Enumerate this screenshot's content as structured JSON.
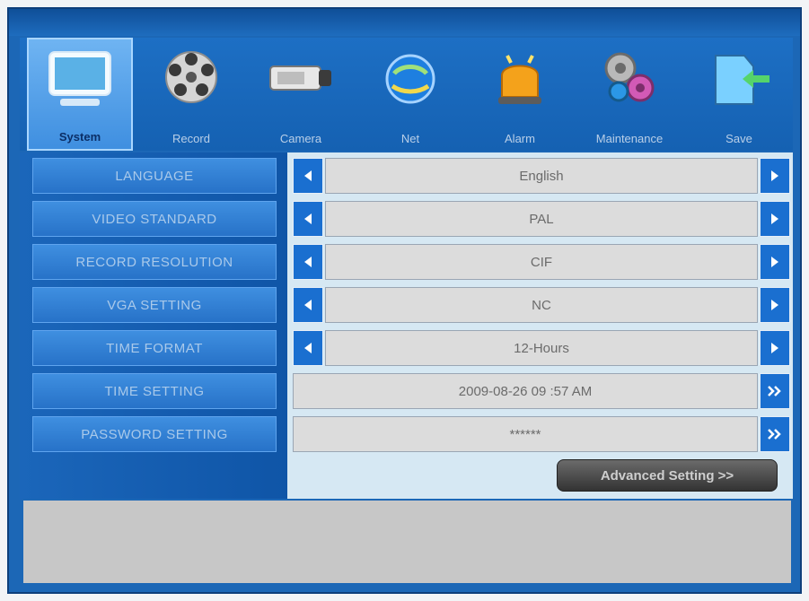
{
  "toolbar": {
    "tabs": [
      {
        "label": "System",
        "icon": "monitor-icon",
        "active": true
      },
      {
        "label": "Record",
        "icon": "film-reel-icon",
        "active": false
      },
      {
        "label": "Camera",
        "icon": "camera-icon",
        "active": false
      },
      {
        "label": "Net",
        "icon": "globe-icon",
        "active": false
      },
      {
        "label": "Alarm",
        "icon": "alarm-light-icon",
        "active": false
      },
      {
        "label": "Maintenance",
        "icon": "gears-icon",
        "active": false
      },
      {
        "label": "Save",
        "icon": "save-folder-icon",
        "active": false
      }
    ]
  },
  "settings": {
    "language": {
      "label": "LANGUAGE",
      "value": "English"
    },
    "video_standard": {
      "label": "VIDEO STANDARD",
      "value": "PAL"
    },
    "record_resolution": {
      "label": "RECORD RESOLUTION",
      "value": "CIF"
    },
    "vga_setting": {
      "label": "VGA SETTING",
      "value": "NC"
    },
    "time_format": {
      "label": "TIME FORMAT",
      "value": "12-Hours"
    },
    "time_setting": {
      "label": "TIME SETTING",
      "value": "2009-08-26 09 :57 AM"
    },
    "password_setting": {
      "label": "PASSWORD SETTING",
      "value": "******"
    }
  },
  "advanced_button": {
    "label": "Advanced Setting >>"
  },
  "colors": {
    "accent": "#1a6fd0",
    "panel": "#d6e8f3",
    "dark_button": "#444444"
  }
}
